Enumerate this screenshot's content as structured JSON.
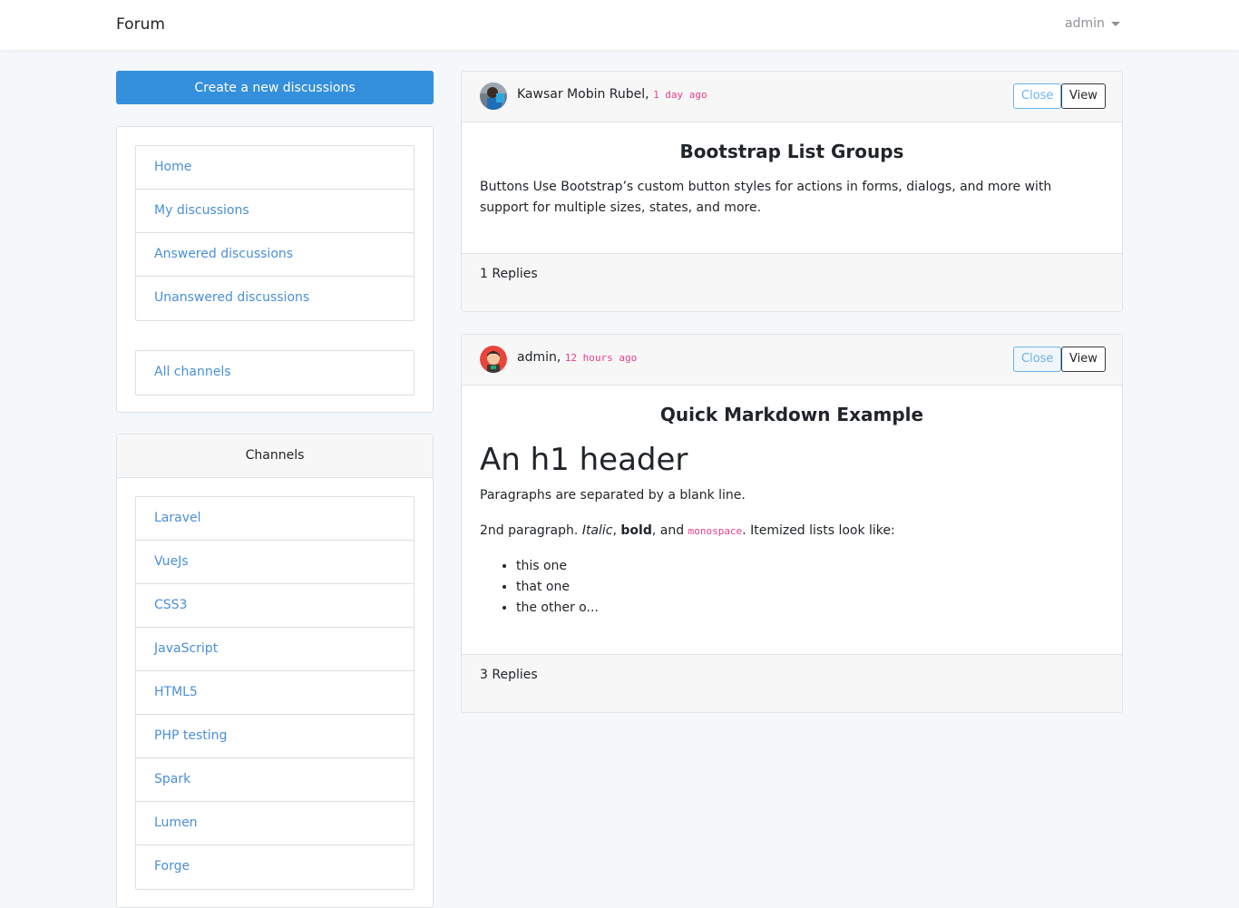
{
  "navbar": {
    "brand": "Forum",
    "user": "admin"
  },
  "sidebar": {
    "create_button": "Create a new discussions",
    "nav_items": [
      {
        "label": "Home"
      },
      {
        "label": "My discussions"
      },
      {
        "label": "Answered discussions"
      },
      {
        "label": "Unanswered discussions"
      }
    ],
    "all_channels": "All channels",
    "channels_title": "Channels",
    "channels": [
      {
        "label": "Laravel"
      },
      {
        "label": "VueJs"
      },
      {
        "label": "CSS3"
      },
      {
        "label": "JavaScript"
      },
      {
        "label": "HTML5"
      },
      {
        "label": "PHP testing"
      },
      {
        "label": "Spark"
      },
      {
        "label": "Lumen"
      },
      {
        "label": "Forge"
      }
    ]
  },
  "posts": [
    {
      "author": "Kawsar Mobin Rubel,",
      "time": "1 day ago",
      "close_label": "Close",
      "view_label": "View",
      "title": "Bootstrap List Groups",
      "body": "Buttons Use Bootstrap’s custom button styles for actions in forms, dialogs, and more with support for multiple sizes, states, and more.",
      "replies": "1 Replies"
    },
    {
      "author": "admin,",
      "time": "12 hours ago",
      "close_label": "Close",
      "view_label": "View",
      "title": "Quick Markdown Example",
      "md": {
        "h1": "An h1 header",
        "p1": "Paragraphs are separated by a blank line.",
        "p2_start": "2nd paragraph. ",
        "p2_italic": "Italic",
        "p2_sep1": ", ",
        "p2_bold": "bold",
        "p2_sep2": ", and ",
        "p2_code": "monospace",
        "p2_end": ". Itemized lists look like:",
        "list": [
          "this one",
          "that one",
          "the other o..."
        ]
      },
      "replies": "3 Replies"
    }
  ],
  "colors": {
    "primary": "#3490dc",
    "link": "#4a8fd6",
    "time": "#e83e8c",
    "close_outline": "#6cb2eb"
  }
}
